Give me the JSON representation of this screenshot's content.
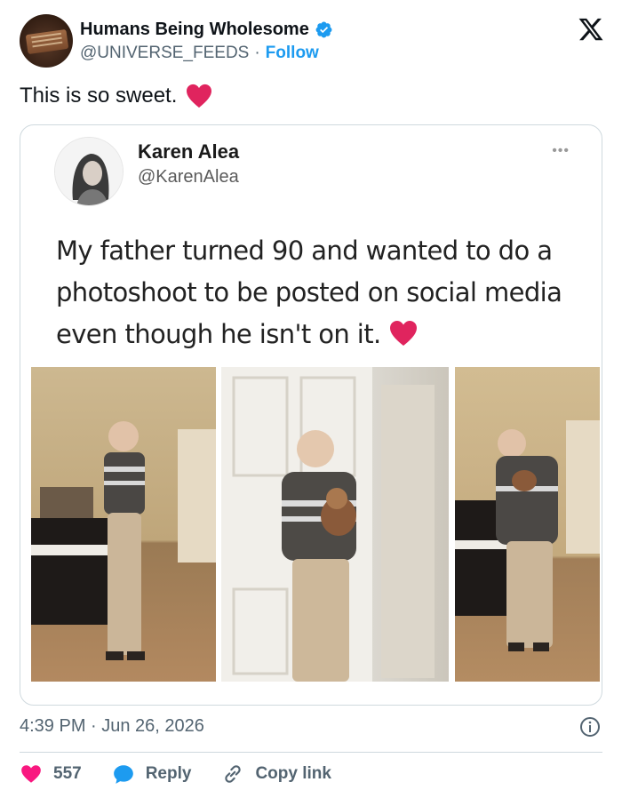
{
  "account": {
    "display_name": "Humans Being Wholesome",
    "handle": "@UNIVERSE_FEEDS",
    "separator": "·",
    "follow_label": "Follow"
  },
  "tweet": {
    "text": "This is so sweet.",
    "emoji": "red-heart-emoji"
  },
  "quoted_post": {
    "display_name": "Karen Alea",
    "handle": "@KarenAlea",
    "more_label": "•••",
    "text": "My father turned 90 and wanted to do a photoshoot to be posted on social media even though he isn't on it.",
    "photos": [
      "photo-by-piano",
      "photo-at-door-with-dog",
      "photo-hugging-dog"
    ]
  },
  "meta": {
    "timestamp": "4:39 PM · Jun 26, 2026"
  },
  "actions": {
    "like_count": "557",
    "reply_label": "Reply",
    "copy_label": "Copy link"
  },
  "colors": {
    "accent": "#1d9bf0",
    "like": "#f91880",
    "text": "#0f1419",
    "secondary": "#536471",
    "border": "#cfd9de"
  },
  "icons": [
    "verified-icon",
    "x-logo-icon",
    "info-icon",
    "heart-icon",
    "reply-icon",
    "link-icon"
  ]
}
